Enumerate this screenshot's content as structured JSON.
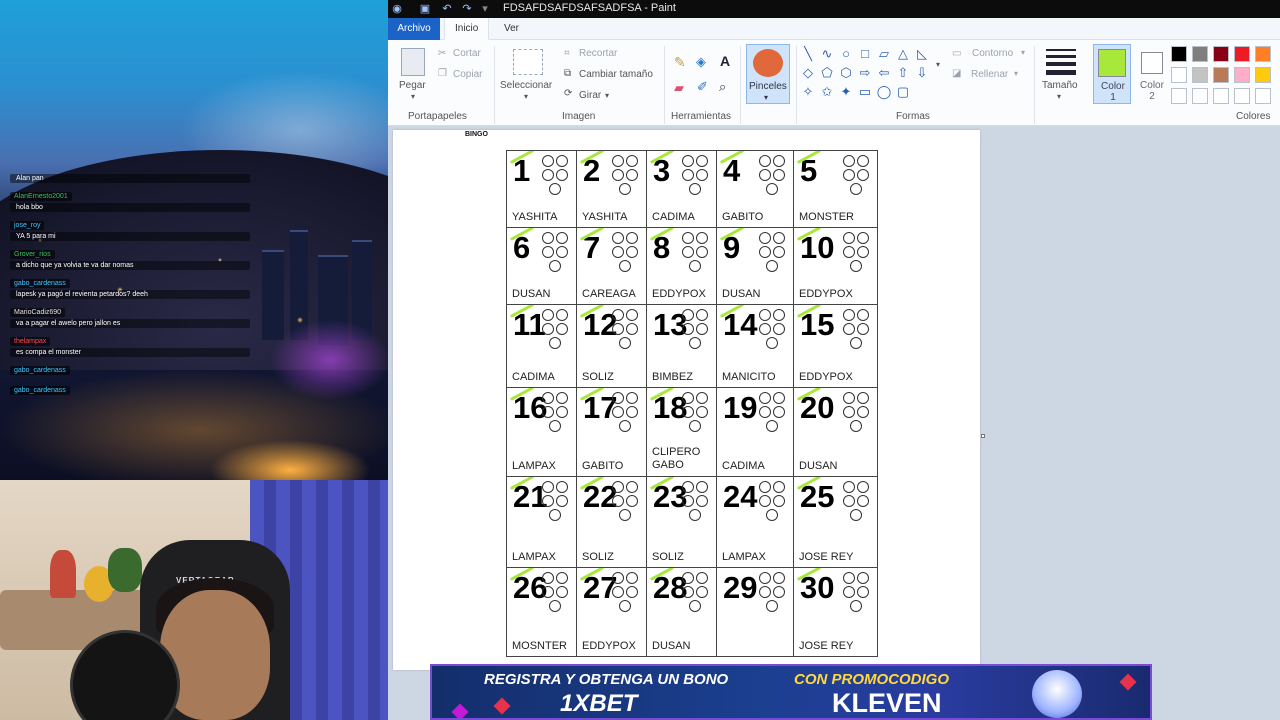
{
  "window": {
    "title": "FDSAFDSAFDSAFSADFSA - Paint"
  },
  "tabs": {
    "file": "Archivo",
    "home": "Inicio",
    "view": "Ver"
  },
  "ribbon": {
    "clipboard": {
      "paste": "Pegar",
      "cut": "Cortar",
      "copy": "Copiar",
      "group": "Portapapeles"
    },
    "image": {
      "select": "Seleccionar",
      "crop": "Recortar",
      "resize": "Cambiar tamaño",
      "rotate": "Girar",
      "group": "Imagen"
    },
    "tools": {
      "group": "Herramientas"
    },
    "brushes": {
      "label": "Pinceles"
    },
    "shapes": {
      "outline": "Contorno",
      "fill": "Rellenar",
      "group": "Formas"
    },
    "size": {
      "label": "Tamaño"
    },
    "color1": {
      "label": "Color 1",
      "value": "#a8e83a"
    },
    "color2": {
      "label": "Color 2",
      "value": "#ffffff"
    },
    "colors": {
      "group": "Colores"
    },
    "palette": [
      "#000000",
      "#7f7f7f",
      "#880015",
      "#ed1c24",
      "#ff7f27",
      "#ffffff",
      "#c3c3c3",
      "#b97a57",
      "#ffaec9",
      "#ffc90e"
    ]
  },
  "document": {
    "title": "BINGO",
    "cells": [
      {
        "n": "1",
        "name": "YASHITA",
        "marked": true
      },
      {
        "n": "2",
        "name": "YASHITA",
        "marked": true
      },
      {
        "n": "3",
        "name": "CADIMA",
        "marked": true
      },
      {
        "n": "4",
        "name": "GABITO",
        "marked": true
      },
      {
        "n": "5",
        "name": "MONSTER",
        "marked": true
      },
      {
        "n": "6",
        "name": "DUSAN",
        "marked": true
      },
      {
        "n": "7",
        "name": "CAREAGA",
        "marked": true
      },
      {
        "n": "8",
        "name": "EDDYPOX",
        "marked": true
      },
      {
        "n": "9",
        "name": "DUSAN",
        "marked": true
      },
      {
        "n": "10",
        "name": "EDDYPOX",
        "marked": true
      },
      {
        "n": "11",
        "name": "CADIMA",
        "marked": true
      },
      {
        "n": "12",
        "name": "SOLIZ",
        "marked": true
      },
      {
        "n": "13",
        "name": "BIMBEZ",
        "marked": false
      },
      {
        "n": "14",
        "name": "MANICITO",
        "marked": true
      },
      {
        "n": "15",
        "name": "EDDYPOX",
        "marked": true
      },
      {
        "n": "16",
        "name": "LAMPAX",
        "marked": true
      },
      {
        "n": "17",
        "name": "GABITO",
        "marked": true
      },
      {
        "n": "18",
        "name": "CLIPERO GABO",
        "marked": true
      },
      {
        "n": "19",
        "name": "CADIMA",
        "marked": false
      },
      {
        "n": "20",
        "name": "DUSAN",
        "marked": true
      },
      {
        "n": "21",
        "name": "LAMPAX",
        "marked": true
      },
      {
        "n": "22",
        "name": "SOLIZ",
        "marked": true
      },
      {
        "n": "23",
        "name": "SOLIZ",
        "marked": true
      },
      {
        "n": "24",
        "name": "LAMPAX",
        "marked": false
      },
      {
        "n": "25",
        "name": "JOSE REY",
        "marked": true
      },
      {
        "n": "26",
        "name": "MOSNTER",
        "marked": true
      },
      {
        "n": "27",
        "name": "EDDYPOX",
        "marked": true
      },
      {
        "n": "28",
        "name": "DUSAN",
        "marked": true
      },
      {
        "n": "29",
        "name": "",
        "marked": false
      },
      {
        "n": "30",
        "name": "JOSE REY",
        "marked": true
      }
    ]
  },
  "chat": [
    {
      "user": "",
      "text": "Alan pan"
    },
    {
      "user": "AlanErnesto2001",
      "text": "hola bbo"
    },
    {
      "user": "jose_roy",
      "text": "YA 5 para mi"
    },
    {
      "user": "Grover_rios",
      "text": "a dicho que ya volvia te va dar nomas"
    },
    {
      "user": "gabo_cardenass",
      "text": "lapesk ya pagó el revienta petardos? deeh"
    },
    {
      "user": "MarioCadiz690",
      "text": "va a pagar el awelo pero jallon es"
    },
    {
      "user": "thelampax",
      "text": "es compa el monster"
    },
    {
      "user": "gabo_cardenass",
      "text": ""
    },
    {
      "user": "gabo_cardenass",
      "text": ""
    }
  ],
  "webcam": {
    "chair_brand": "VERTAGEAR"
  },
  "banner": {
    "line1": "REGISTRA Y OBTENGA UN BONO",
    "brand": "1XBET",
    "line2": "CON PROMOCODIGO",
    "code": "KLEVEN"
  }
}
